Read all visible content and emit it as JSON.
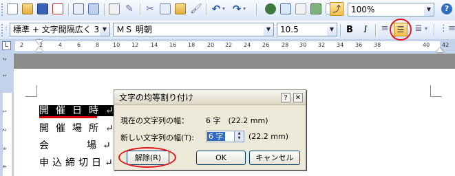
{
  "toolbar": {
    "zoom_value": "100%",
    "style_value": "標準 + 文字間隔広く 3.",
    "font_value": "ＭＳ 明朝",
    "size_value": "10.5",
    "bold_label": "B",
    "italic_label": "I"
  },
  "ruler": {
    "ticks": [
      "2",
      "2",
      "4",
      "6",
      "8",
      "10",
      "12",
      "14",
      "16",
      "18",
      "20",
      "22",
      "24",
      "26",
      "28",
      "30",
      "32",
      "34",
      "36",
      "38",
      "40",
      "42"
    ]
  },
  "vruler": {
    "ticks": [
      "2",
      "1",
      "1",
      "2",
      "3",
      "4"
    ]
  },
  "document": {
    "lines": [
      "開催日時↵",
      "開催場所↵",
      "会　　場↵",
      "申込締切日↵"
    ]
  },
  "dialog": {
    "title": "文字の均等割り付け",
    "current_label": "現在の文字列の幅：",
    "current_value": "6 字　(22.2 mm)",
    "new_label": "新しい文字列の幅(T):",
    "new_value": "6 字",
    "new_mm": "(22.2 mm)",
    "release_label": "解除(R)",
    "ok_label": "OK",
    "cancel_label": "キャンセル"
  },
  "colors": {
    "highlight_ring": "#e0161c",
    "selection_underline": "#d40000",
    "toggle_active": "#f5bd4b"
  }
}
